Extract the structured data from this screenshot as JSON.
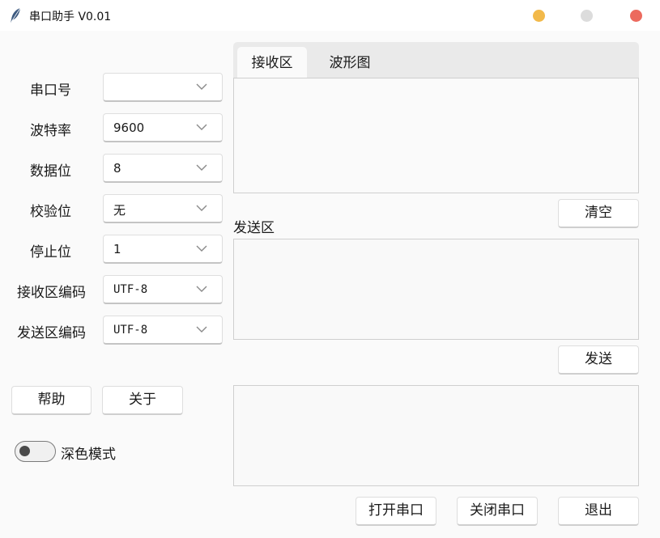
{
  "window": {
    "title": "串口助手 V0.01",
    "icon": "feather-icon",
    "controls": {
      "minimize": "#f2b94a",
      "maximize": "#dcdcdc",
      "close": "#ec6a5e"
    }
  },
  "settings": {
    "port": {
      "label": "串口号",
      "value": ""
    },
    "baud": {
      "label": "波特率",
      "value": "9600"
    },
    "databits": {
      "label": "数据位",
      "value": "8"
    },
    "parity": {
      "label": "校验位",
      "value": "无"
    },
    "stopbits": {
      "label": "停止位",
      "value": "1"
    },
    "rx_encoding": {
      "label": "接收区编码",
      "value": "UTF-8"
    },
    "tx_encoding": {
      "label": "发送区编码",
      "value": "UTF-8"
    }
  },
  "buttons": {
    "help": "帮助",
    "about": "关于",
    "clear": "清空",
    "send": "发送",
    "open_port": "打开串口",
    "close_port": "关闭串口",
    "exit": "退出"
  },
  "dark_mode": {
    "label": "深色模式",
    "enabled": false
  },
  "tabs": [
    {
      "label": "接收区",
      "active": true
    },
    {
      "label": "波形图",
      "active": false
    }
  ],
  "send_section": {
    "label": "发送区"
  },
  "text_areas": {
    "receive": "",
    "send": "",
    "log": ""
  }
}
